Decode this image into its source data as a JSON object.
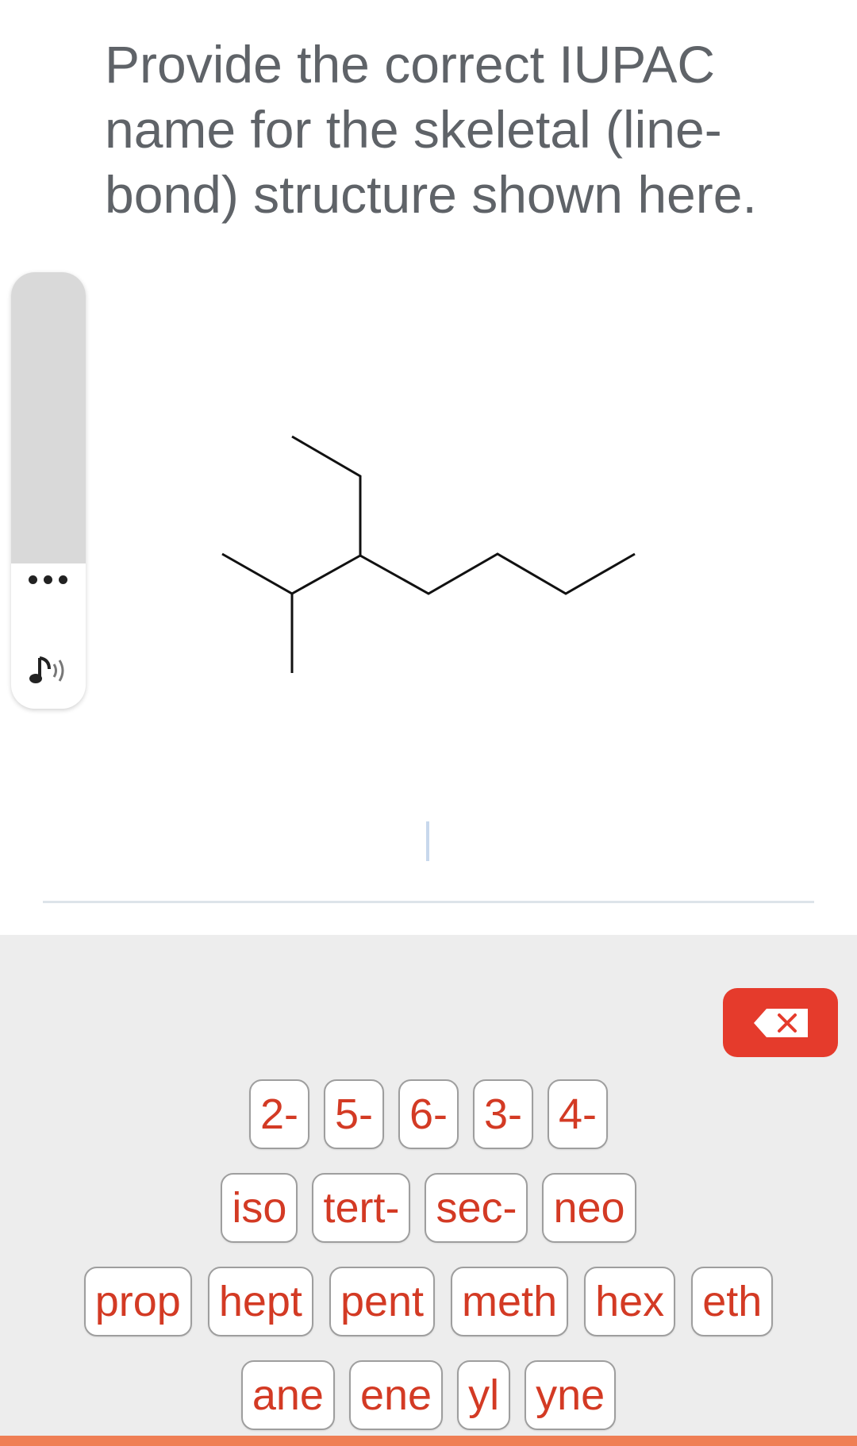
{
  "question": {
    "text": "Provide the correct IUPAC name for the skeletal (line-bond) structure shown here."
  },
  "side_panel": {
    "more_icon": "more-dots-icon",
    "audio_icon": "audio-speaker-icon"
  },
  "keyboard": {
    "delete_icon": "backspace-icon",
    "rows": [
      [
        "2-",
        "5-",
        "6-",
        "3-",
        "4-"
      ],
      [
        "iso",
        "tert-",
        "sec-",
        "neo"
      ],
      [
        "prop",
        "hept",
        "pent",
        "meth",
        "hex",
        "eth"
      ],
      [
        "ane",
        "ene",
        "yl",
        "yne"
      ]
    ]
  },
  "colors": {
    "key_text": "#d33a24",
    "delete_button": "#e53b2c",
    "keyboard_background": "#ededed",
    "bottom_strip": "#ef7f55",
    "question_text": "#5f6368"
  }
}
